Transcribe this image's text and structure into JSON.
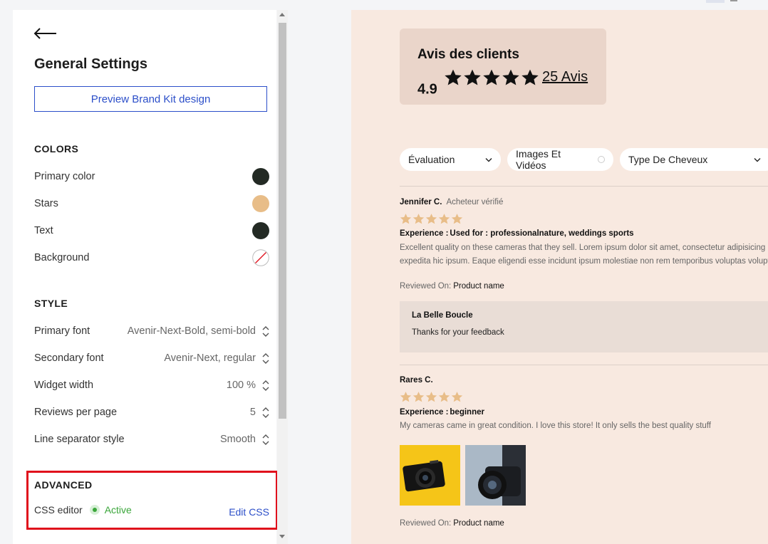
{
  "panel": {
    "title": "General Settings",
    "preview_button": "Preview Brand Kit design",
    "colors": {
      "section_title": "COLORS",
      "items": [
        {
          "label": "Primary color",
          "color": "#232a24"
        },
        {
          "label": "Stars",
          "color": "#e8bd88"
        },
        {
          "label": "Text",
          "color": "#232a24"
        },
        {
          "label": "Background",
          "color": "none"
        }
      ]
    },
    "style": {
      "section_title": "STYLE",
      "items": [
        {
          "label": "Primary font",
          "value": "Avenir-Next-Bold, semi-bold"
        },
        {
          "label": "Secondary font",
          "value": "Avenir-Next, regular"
        },
        {
          "label": "Widget width",
          "value": "100 %"
        },
        {
          "label": "Reviews per page",
          "value": "5"
        },
        {
          "label": "Line separator style",
          "value": "Smooth"
        }
      ]
    },
    "advanced": {
      "section_title": "ADVANCED",
      "css_editor_label": "CSS editor",
      "status": "Active",
      "edit_link": "Edit CSS"
    }
  },
  "preview": {
    "summary": {
      "title": "Avis des clients",
      "score": "4.9",
      "rating": 5,
      "link": "25 Avis"
    },
    "filters": [
      {
        "label": "Évaluation"
      },
      {
        "label": "Images Et Vidéos"
      },
      {
        "label": "Type De Cheveux"
      }
    ],
    "reviews": [
      {
        "author": "Jennifer C.",
        "verified": "Acheteur vérifié",
        "rating": 5,
        "experience_key": "Experience :",
        "experience_value": "Used for : professionalnature, weddings sports",
        "text_line_1": "Excellent quality on these cameras that they sell. Lorem ipsum dolor sit amet, consectetur adipisicing elit. Aperiam quae",
        "text_line_2": "expedita hic ipsum. Eaque eligendi esse incidunt ipsum molestiae non rem temporibus voluptas voluptatem.",
        "reviewed_on_label": "Reviewed On:",
        "product": "Product name",
        "reply": {
          "author": "La Belle Boucle",
          "text": "Thanks for your feedback"
        }
      },
      {
        "author": "Rares C.",
        "rating": 5,
        "experience_key": "Experience :",
        "experience_value": "beginner",
        "text_line_1": "My cameras came in great condition. I love this store! It only sells the best quality stuff",
        "reviewed_on_label": "Reviewed On:",
        "product": "Product name",
        "photos": [
          "camera-photo-1",
          "camera-photo-2"
        ]
      }
    ],
    "star_color": "#e8bd88",
    "background": "#f8e9e0"
  }
}
